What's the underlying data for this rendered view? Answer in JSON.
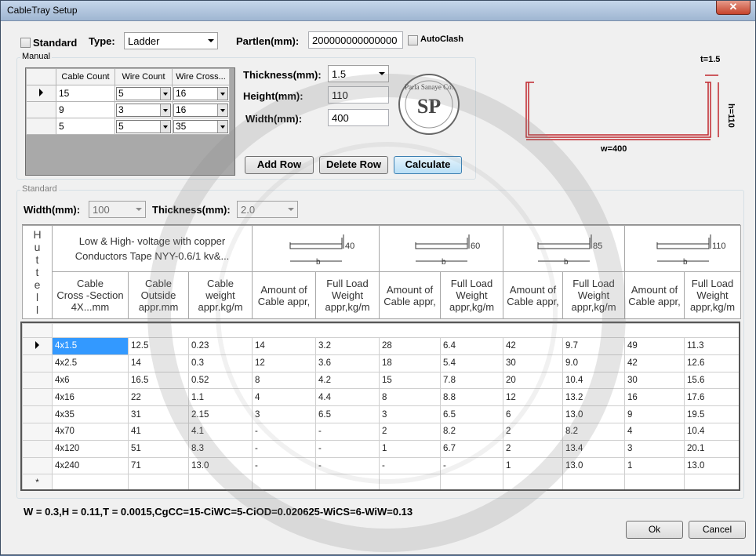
{
  "window": {
    "title": "CableTray Setup",
    "close_glyph": "✕"
  },
  "top": {
    "standard_label": "Standard",
    "type_label": "Type:",
    "type_value": "Ladder",
    "partlen_label": "Partlen(mm):",
    "partlen_value": "200000000000000",
    "autoclash_label": "AutoClash"
  },
  "manual": {
    "group_title": "Manual",
    "columns": [
      "Cable Count",
      "Wire Count",
      "Wire Cross..."
    ],
    "rows": [
      {
        "cable_count": "15",
        "wire_count": "5",
        "wire_cross": "16"
      },
      {
        "cable_count": "9",
        "wire_count": "3",
        "wire_cross": "16"
      },
      {
        "cable_count": "5",
        "wire_count": "5",
        "wire_cross": "35"
      }
    ],
    "thickness_label": "Thickness(mm):",
    "thickness_value": "1.5",
    "height_label": "Height(mm):",
    "height_value": "110",
    "width_label": "Width(mm):",
    "width_value": "400",
    "add_row": "Add Row",
    "delete_row": "Delete Row",
    "calculate": "Calculate"
  },
  "logo": {
    "name": "Parla Sanaye Co.",
    "initials": "SP"
  },
  "diagram": {
    "t_label": "t=1.5",
    "h_label": "h=110",
    "w_label": "w=400"
  },
  "standard": {
    "group_title": "Standard",
    "width_label": "Width(mm):",
    "width_value": "100",
    "thickness_label": "Thickness(mm):",
    "thickness_value": "2.0",
    "vertical_title": [
      "H",
      "u",
      "t",
      "t",
      "e",
      "l",
      "l"
    ],
    "desc_line1": "Low & High- voltage with copper",
    "desc_line2": "Conductors Tape NYY-0.6/1 kv&...",
    "tray_heights": [
      "40",
      "60",
      "85",
      "110"
    ],
    "tray_b_label": "b",
    "col_headers": [
      [
        "Cable",
        "Cross -Section",
        "4X...mm"
      ],
      [
        "Cable",
        "Outside",
        "appr.mm"
      ],
      [
        "Cable",
        "weight",
        "appr.kg/m"
      ]
    ],
    "amount_header": [
      "Amount of",
      "Cable appr,"
    ],
    "full_load_header": [
      "Full Load",
      "Weight",
      "appr,kg/m"
    ]
  },
  "data_rows": [
    [
      "4x1.5",
      "12.5",
      "0.23",
      "14",
      "3.2",
      "28",
      "6.4",
      "42",
      "9.7",
      "49",
      "11.3"
    ],
    [
      "4x2.5",
      "14",
      "0.3",
      "12",
      "3.6",
      "18",
      "5.4",
      "30",
      "9.0",
      "42",
      "12.6"
    ],
    [
      "4x6",
      "16.5",
      "0.52",
      "8",
      "4.2",
      "15",
      "7.8",
      "20",
      "10.4",
      "30",
      "15.6"
    ],
    [
      "4x16",
      "22",
      "1.1",
      "4",
      "4.4",
      "8",
      "8.8",
      "12",
      "13.2",
      "16",
      "17.6"
    ],
    [
      "4x35",
      "31",
      "2.15",
      "3",
      "6.5",
      "3",
      "6.5",
      "6",
      "13.0",
      "9",
      "19.5"
    ],
    [
      "4x70",
      "41",
      "4.1",
      "-",
      "-",
      "2",
      "8.2",
      "2",
      "8.2",
      "4",
      "10.4"
    ],
    [
      "4x120",
      "51",
      "8.3",
      "-",
      "-",
      "1",
      "6.7",
      "2",
      "13.4",
      "3",
      "20.1"
    ],
    [
      "4x240",
      "71",
      "13.0",
      "-",
      "-",
      "-",
      "-",
      "1",
      "13.0",
      "1",
      "13.0"
    ]
  ],
  "new_row_glyph": "*",
  "status": "W = 0.3,H = 0.11,T = 0.0015,CgCC=15-CiWC=5-CiOD=0.020625-WiCS=6-WiW=0.13",
  "buttons": {
    "ok": "Ok",
    "cancel": "Cancel"
  },
  "colors": {
    "diagram_red": "#c0272d",
    "selection_blue": "#3399ff"
  }
}
